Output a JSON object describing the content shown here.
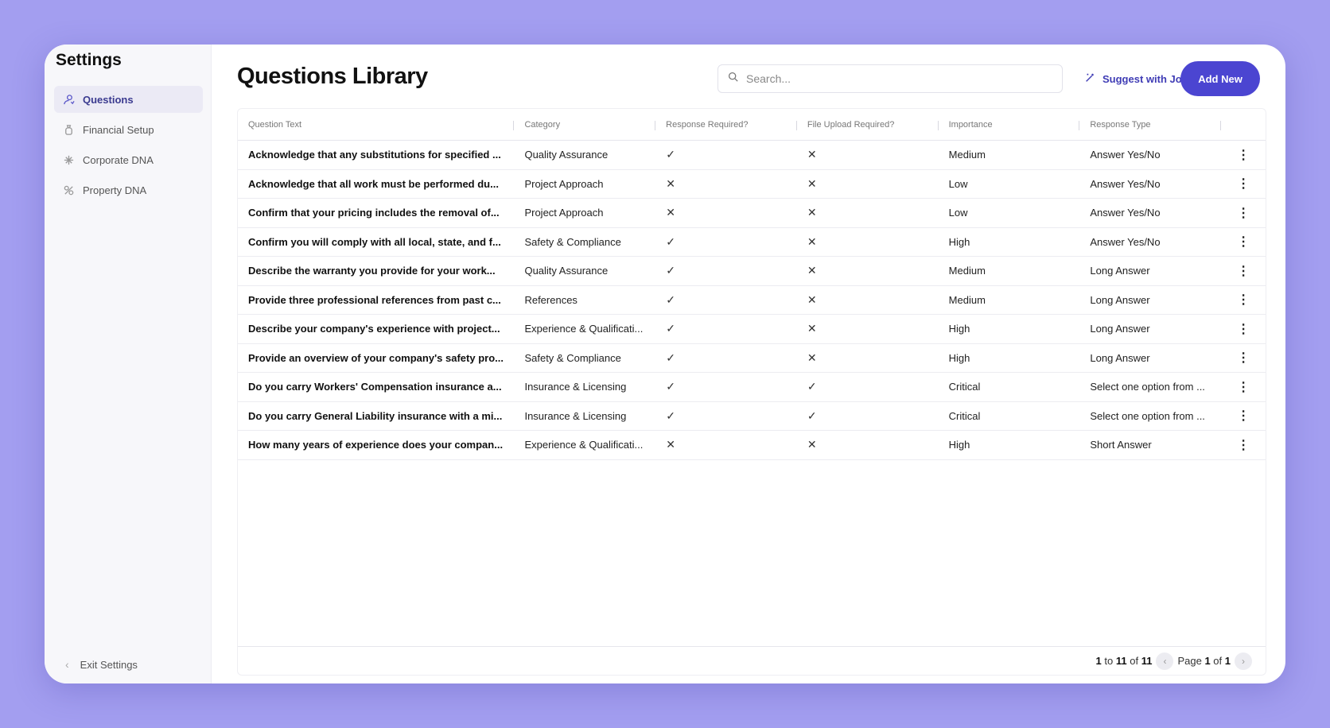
{
  "sidebar": {
    "title": "Settings",
    "items": [
      {
        "label": "Questions",
        "icon": "questions-icon",
        "active": true
      },
      {
        "label": "Financial Setup",
        "icon": "money-bag-icon",
        "active": false
      },
      {
        "label": "Corporate DNA",
        "icon": "sparkle-icon",
        "active": false
      },
      {
        "label": "Property DNA",
        "icon": "property-icon",
        "active": false
      }
    ],
    "exit_label": "Exit Settings"
  },
  "header": {
    "title": "Questions Library",
    "search_placeholder": "Search...",
    "suggest_label": "Suggest with Joy",
    "add_label": "Add New"
  },
  "table": {
    "columns": [
      "Question Text",
      "Category",
      "Response Required?",
      "File Upload Required?",
      "Importance",
      "Response Type"
    ],
    "rows": [
      {
        "question": "Acknowledge that any substitutions for specified ...",
        "category": "Quality Assurance",
        "response_required": "✓",
        "file_upload": "✕",
        "importance": "Medium",
        "response_type": "Answer Yes/No"
      },
      {
        "question": "Acknowledge that all work must be performed du...",
        "category": "Project Approach",
        "response_required": "✕",
        "file_upload": "✕",
        "importance": "Low",
        "response_type": "Answer Yes/No"
      },
      {
        "question": "Confirm that your pricing includes the removal of...",
        "category": "Project Approach",
        "response_required": "✕",
        "file_upload": "✕",
        "importance": "Low",
        "response_type": "Answer Yes/No"
      },
      {
        "question": "Confirm you will comply with all local, state, and f...",
        "category": "Safety & Compliance",
        "response_required": "✓",
        "file_upload": "✕",
        "importance": "High",
        "response_type": "Answer Yes/No"
      },
      {
        "question": "Describe the warranty you provide for your work...",
        "category": "Quality Assurance",
        "response_required": "✓",
        "file_upload": "✕",
        "importance": "Medium",
        "response_type": "Long Answer"
      },
      {
        "question": "Provide three professional references from past c...",
        "category": "References",
        "response_required": "✓",
        "file_upload": "✕",
        "importance": "Medium",
        "response_type": "Long Answer"
      },
      {
        "question": "Describe your company's experience with project...",
        "category": "Experience & Qualificati...",
        "response_required": "✓",
        "file_upload": "✕",
        "importance": "High",
        "response_type": "Long Answer"
      },
      {
        "question": "Provide an overview of your company's safety pro...",
        "category": "Safety & Compliance",
        "response_required": "✓",
        "file_upload": "✕",
        "importance": "High",
        "response_type": "Long Answer"
      },
      {
        "question": "Do you carry Workers' Compensation insurance a...",
        "category": "Insurance & Licensing",
        "response_required": "✓",
        "file_upload": "✓",
        "importance": "Critical",
        "response_type": "Select one option from ..."
      },
      {
        "question": "Do you carry General Liability insurance with a mi...",
        "category": "Insurance & Licensing",
        "response_required": "✓",
        "file_upload": "✓",
        "importance": "Critical",
        "response_type": "Select one option from ..."
      },
      {
        "question": "How many years of experience does your compan...",
        "category": "Experience & Qualificati...",
        "response_required": "✕",
        "file_upload": "✕",
        "importance": "High",
        "response_type": "Short Answer"
      }
    ]
  },
  "pagination": {
    "range_start": "1",
    "to_text": "to",
    "range_end": "11",
    "of_text": "of",
    "total": "11",
    "page_text": "Page",
    "current_page": "1",
    "page_of_text": "of",
    "total_pages": "1"
  },
  "colors": {
    "accent": "#4b45d1",
    "background": "#a39ef0"
  }
}
